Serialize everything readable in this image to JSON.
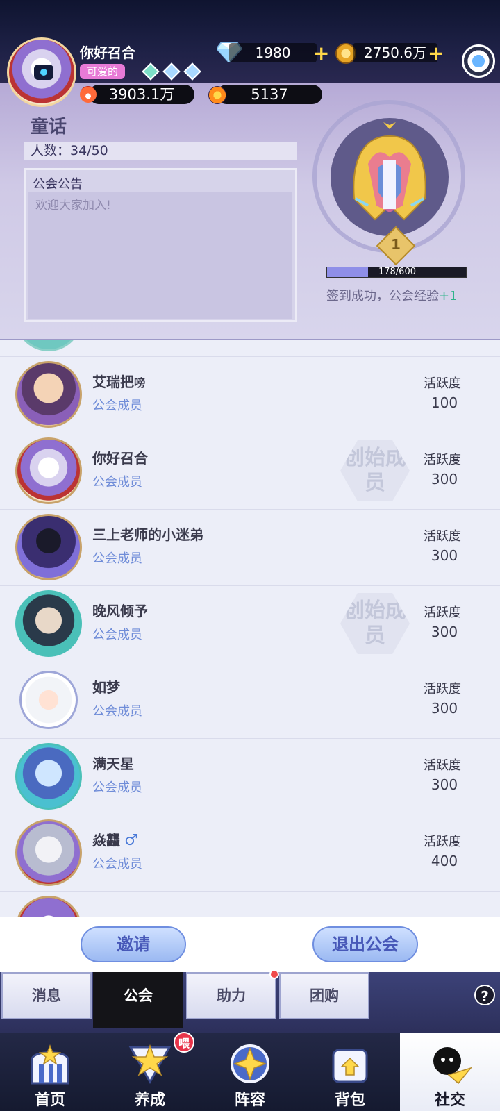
{
  "player": {
    "name": "你好召合",
    "title": "可爱的",
    "power": "3903.1万",
    "stars": "5137"
  },
  "currency": {
    "diamonds": "1980",
    "gold": "2750.6万"
  },
  "guild": {
    "name": "童话",
    "member_count": "人数：34/50",
    "notice_title": "公会公告",
    "notice_text": "欢迎大家加入!",
    "level": "1",
    "exp_text": "178/600",
    "exp_current": 178,
    "exp_max": 600,
    "checkin_msg": "签到成功，公会经验",
    "checkin_bonus": "+1"
  },
  "members": [
    {
      "name": "艾瑞把",
      "name_suffix": "嗙",
      "role": "公会成员",
      "activity_label": "活跃度",
      "activity": "100",
      "founder": false
    },
    {
      "name": "你好召合",
      "role": "公会成员",
      "activity_label": "活跃度",
      "activity": "300",
      "founder": true
    },
    {
      "name": "三上老师的小迷弟",
      "role": "公会成员",
      "activity_label": "活跃度",
      "activity": "300",
      "founder": false
    },
    {
      "name": "晚风倾予",
      "role": "公会成员",
      "activity_label": "活跃度",
      "activity": "300",
      "founder": true
    },
    {
      "name": "如梦",
      "role": "公会成员",
      "activity_label": "活跃度",
      "activity": "300",
      "founder": false
    },
    {
      "name": "满天星",
      "role": "公会成员",
      "activity_label": "活跃度",
      "activity": "300",
      "founder": false
    },
    {
      "name": "焱龘",
      "role": "公会成员",
      "activity_label": "活跃度",
      "activity": "400",
      "founder": false
    }
  ],
  "founder_stamp": "创始成员",
  "actions": {
    "invite": "邀请",
    "leave": "退出公会"
  },
  "tabs": [
    "消息",
    "公会",
    "助力",
    "团购"
  ],
  "nav": [
    "首页",
    "养成",
    "阵容",
    "背包",
    "社交"
  ],
  "badge": "喂",
  "colors": {
    "accent": "#6f8cd8",
    "checkin_green": "#2eb48a"
  }
}
